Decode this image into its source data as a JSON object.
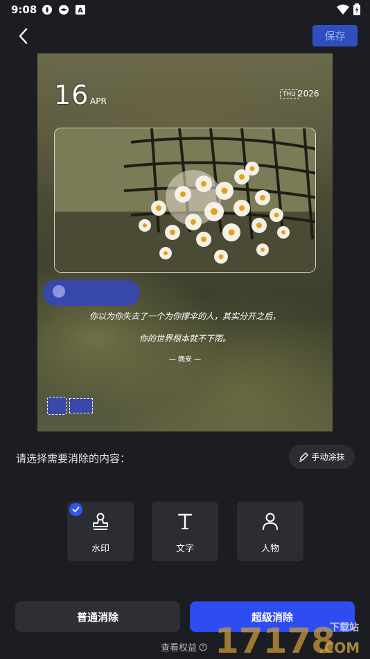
{
  "status_bar": {
    "time": "9:08"
  },
  "header": {
    "save_label": "保存"
  },
  "preview": {
    "day": "16",
    "month": "APR",
    "weekday": "THU",
    "year": "2026",
    "quote_line1": "你以为你失去了一个为你撑伞的人，其实分开之后，",
    "quote_line2": "你的世界根本就不下雨。",
    "quote_sign": "— 晚安 —"
  },
  "panel": {
    "prompt": "请选择需要消除的内容：",
    "manual_label": "手动涂抹",
    "options": [
      {
        "label": "水印",
        "selected": true
      },
      {
        "label": "文字",
        "selected": false
      },
      {
        "label": "人物",
        "selected": false
      }
    ],
    "normal_label": "普通消除",
    "super_label": "超级消除",
    "benefits_label": "查看权益"
  },
  "overlay_watermark": {
    "brand": "17178",
    "suffix": ".COM",
    "tag": "下载站"
  },
  "colors": {
    "accent": "#2e4cf0",
    "panel_bg": "#1c1d22",
    "card_bg": "#2c2d33"
  }
}
